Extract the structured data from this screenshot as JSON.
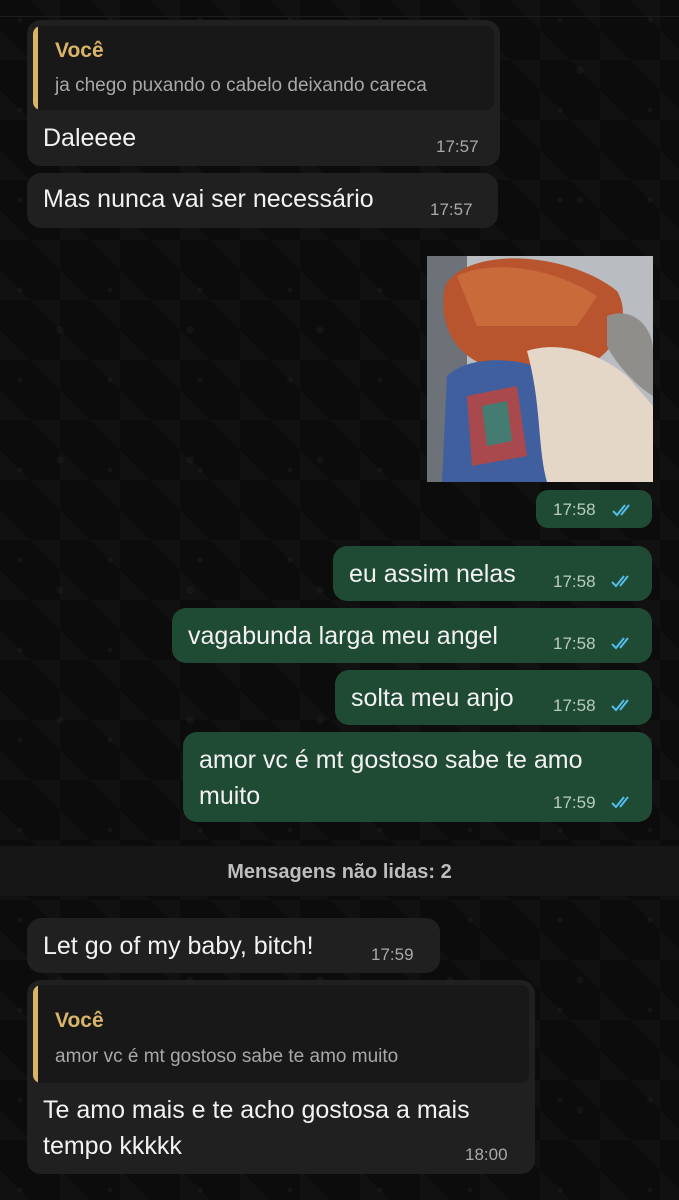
{
  "messages": [
    {
      "id": "m1",
      "direction": "incoming",
      "quote": {
        "author": "Você",
        "text": "ja chego puxando o cabelo deixando careca"
      },
      "text": "Daleeee",
      "time": "17:57"
    },
    {
      "id": "m2",
      "direction": "incoming",
      "text": "Mas nunca vai ser necessário",
      "time": "17:57"
    },
    {
      "id": "m3",
      "direction": "outgoing",
      "media": "gif-image",
      "time": "17:58",
      "status": "read"
    },
    {
      "id": "m4",
      "direction": "outgoing",
      "text": "eu assim nelas",
      "time": "17:58",
      "status": "read"
    },
    {
      "id": "m5",
      "direction": "outgoing",
      "text": "vagabunda larga meu angel",
      "time": "17:58",
      "status": "read"
    },
    {
      "id": "m6",
      "direction": "outgoing",
      "text": "solta meu anjo",
      "time": "17:58",
      "status": "read"
    },
    {
      "id": "m7",
      "direction": "outgoing",
      "text_lines": [
        "amor vc é mt gostoso sabe te amo",
        "muito"
      ],
      "time": "17:59",
      "status": "read"
    },
    {
      "id": "m8",
      "direction": "incoming",
      "text": "Let go of my baby, bitch!",
      "time": "17:59"
    },
    {
      "id": "m9",
      "direction": "incoming",
      "quote": {
        "author": "Você",
        "text": "amor vc é mt gostoso sabe te amo muito"
      },
      "text_lines": [
        "Te amo mais e te acho gostosa a mais",
        "tempo kkkkk"
      ],
      "time": "18:00"
    }
  ],
  "unread_divider": "Mensagens não lidas: 2",
  "colors": {
    "incoming": "#202020",
    "outgoing": "#1f4a33",
    "quote_accent": "#d9b56a",
    "read_ticks": "#53bdeb"
  },
  "icons": {
    "read_status": "double-check-icon"
  }
}
